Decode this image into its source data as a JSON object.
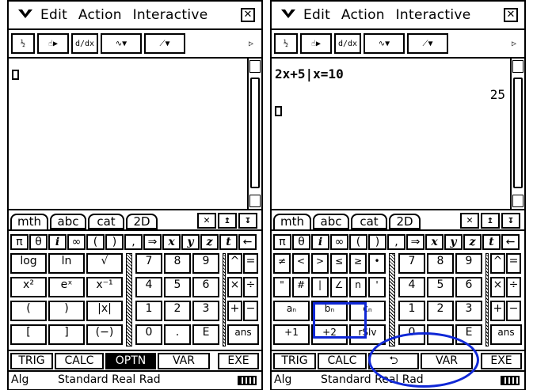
{
  "colors": {
    "accent": "#1028d6",
    "ink": "#000000",
    "screen": "#ffffff"
  },
  "menu": {
    "items": [
      "Edit",
      "Action",
      "Interactive"
    ],
    "arrow_icon": "down-chevron-icon",
    "close_icon": "close-icon"
  },
  "toolbar": {
    "buttons": [
      "0.5 1/2",
      "hand-play",
      "d/dx",
      "graph-dropdown",
      "line-graph-dropdown"
    ]
  },
  "left": {
    "tabs": [
      "mth",
      "abc",
      "cat",
      "2D"
    ],
    "row0": [
      "π",
      "θ",
      "i",
      "∞",
      "(",
      ")",
      ",",
      "⇒",
      "x",
      "y",
      "z",
      "t",
      "←"
    ],
    "grid": [
      [
        "log",
        "ln",
        "√"
      ],
      [
        "x²",
        "eˣ",
        "x⁻¹"
      ],
      [
        "(",
        ")",
        "|x|"
      ],
      [
        "[",
        "]",
        "(−)"
      ]
    ],
    "numpad": [
      [
        "7",
        "8",
        "9"
      ],
      [
        "4",
        "5",
        "6"
      ],
      [
        "1",
        "2",
        "3"
      ],
      [
        "0",
        ".",
        "E"
      ]
    ],
    "ops": [
      [
        "^",
        "="
      ],
      [
        "×",
        "÷"
      ],
      [
        "+",
        "−"
      ],
      [
        "ans",
        ""
      ]
    ],
    "bottom": [
      "TRIG",
      "CALC",
      "OPTN",
      "VAR",
      "EXE"
    ],
    "selected_bottom": "OPTN"
  },
  "right": {
    "tabs": [
      "mth",
      "abc",
      "cat",
      "2D"
    ],
    "entry_line": "2x+5|x=10",
    "result": "25",
    "row0": [
      "π",
      "θ",
      "i",
      "∞",
      "(",
      ")",
      ",",
      "⇒",
      "x",
      "y",
      "z",
      "t",
      "←"
    ],
    "grid": [
      [
        "≠",
        "<",
        ">",
        "≤",
        "≥",
        "•"
      ],
      [
        "\"",
        "#",
        "|",
        "∠",
        "n",
        "'"
      ],
      [
        "aₙ",
        "bₙ",
        "cₙ"
      ],
      [
        "+1",
        "+2",
        "rSlv"
      ]
    ],
    "numpad": [
      [
        "7",
        "8",
        "9"
      ],
      [
        "4",
        "5",
        "6"
      ],
      [
        "1",
        "2",
        "3"
      ],
      [
        "0",
        ".",
        "E"
      ]
    ],
    "ops": [
      [
        "^",
        "="
      ],
      [
        "×",
        "÷"
      ],
      [
        "+",
        "−"
      ],
      [
        "ans",
        ""
      ]
    ],
    "bottom": [
      "TRIG",
      "CALC",
      "⮌",
      "VAR",
      "EXE"
    ]
  },
  "status": {
    "mode": "Alg",
    "text": "Standard Real Rad"
  }
}
